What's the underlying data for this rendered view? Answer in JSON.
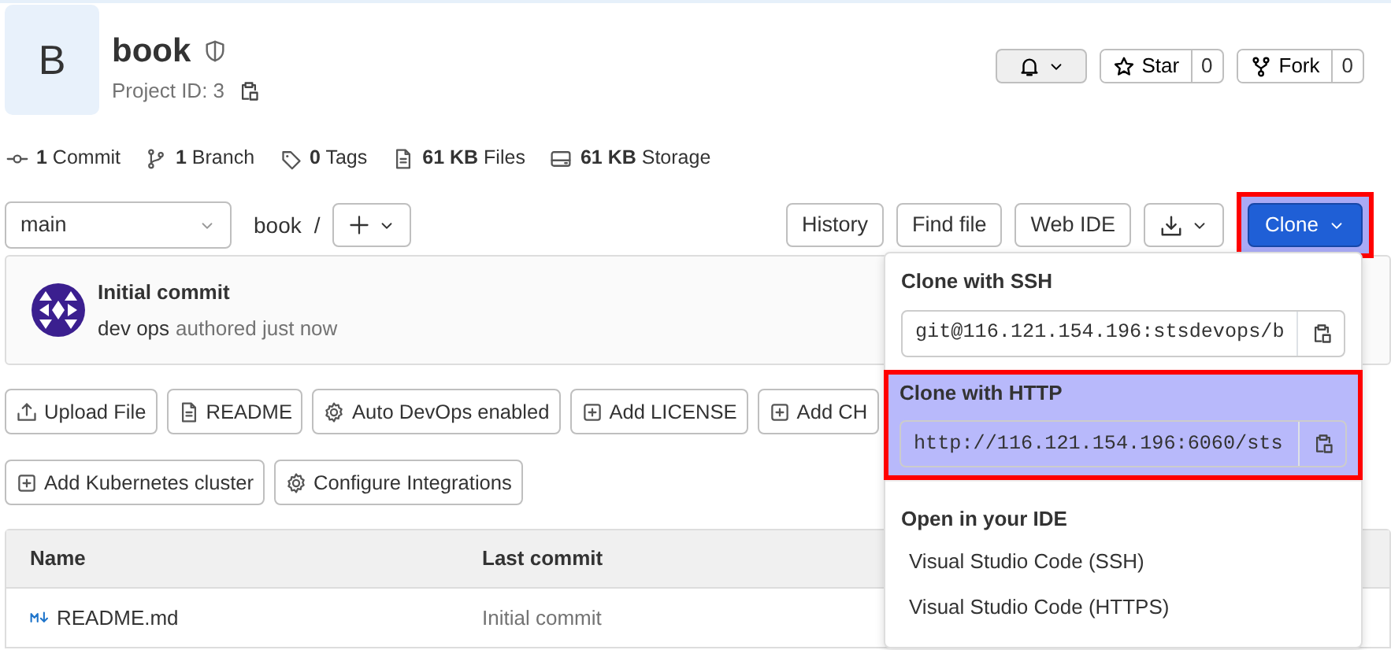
{
  "project": {
    "avatar_letter": "B",
    "name": "book",
    "id_label": "Project ID: 3"
  },
  "header_actions": [
    {
      "kind": "notify"
    },
    {
      "kind": "counter",
      "label": "Star",
      "count": "0"
    },
    {
      "kind": "counter",
      "label": "Fork",
      "count": "0"
    }
  ],
  "stats": [
    {
      "text": "**1** Commit"
    },
    {
      "text": "**1** Branch"
    },
    {
      "text": "**0** Tags"
    },
    {
      "text": "**61 KB** Files"
    },
    {
      "text": "**61 KB** Storage"
    }
  ],
  "branch_select": {
    "value": "main"
  },
  "breadcrumb": [
    "book",
    "/"
  ],
  "toolbar": [
    {
      "kind": "text",
      "label": "History"
    },
    {
      "kind": "text",
      "label": "Find file"
    },
    {
      "kind": "text",
      "label": "Web IDE"
    },
    {
      "kind": "download"
    },
    {
      "kind": "clone",
      "label": "Clone",
      "expanded": true,
      "annotated": true
    }
  ],
  "last_commit": {
    "title": "Initial commit",
    "author": "dev ops",
    "meta": "authored just now"
  },
  "quick_actions": [
    {
      "label": "Upload File"
    },
    {
      "label": "README"
    },
    {
      "label": "Auto DevOps enabled"
    },
    {
      "label": "Add LICENSE"
    },
    {
      "label": "Add CH"
    },
    {
      "label": "Add Kubernetes cluster"
    },
    {
      "label": "Configure Integrations"
    }
  ],
  "file_table": {
    "columns": [
      "Name",
      "Last commit"
    ],
    "rows": [
      {
        "name": "README.md",
        "last_commit": "Initial commit"
      }
    ]
  },
  "clone_menu": {
    "sections": [
      {
        "kind": "url",
        "title": "Clone with SSH",
        "value": "git@116.121.154.196:stsdevops/b",
        "annotated": false
      },
      {
        "kind": "url",
        "title": "Clone with HTTP",
        "value": "http://116.121.154.196:6060/sts",
        "annotated": true
      },
      {
        "kind": "links",
        "title": "Open in your IDE",
        "items": [
          "Visual Studio Code (SSH)",
          "Visual Studio Code (HTTPS)"
        ]
      }
    ]
  }
}
